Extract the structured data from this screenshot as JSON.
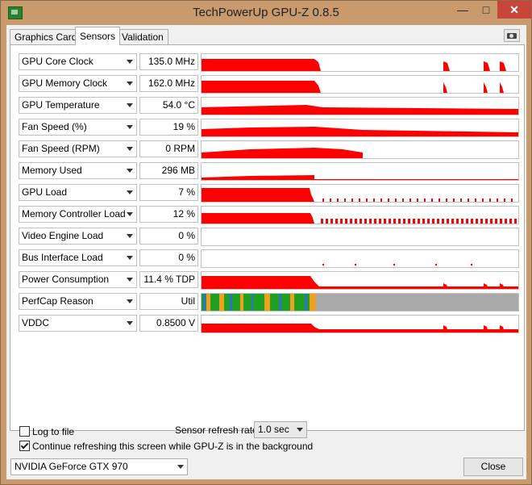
{
  "window": {
    "title": "TechPowerUp GPU-Z 0.8.5",
    "minimize": "—",
    "maximize": "□",
    "close": "✕"
  },
  "tabs": [
    {
      "label": "Graphics Card"
    },
    {
      "label": "Sensors"
    },
    {
      "label": "Validation"
    }
  ],
  "sensors": [
    {
      "name": "GPU Core Clock",
      "value": "135.0 MHz"
    },
    {
      "name": "GPU Memory Clock",
      "value": "162.0 MHz"
    },
    {
      "name": "GPU Temperature",
      "value": "54.0 °C"
    },
    {
      "name": "Fan Speed (%)",
      "value": "19 %"
    },
    {
      "name": "Fan Speed (RPM)",
      "value": "0 RPM"
    },
    {
      "name": "Memory Used",
      "value": "296 MB"
    },
    {
      "name": "GPU Load",
      "value": "7 %"
    },
    {
      "name": "Memory Controller Load",
      "value": "12 %"
    },
    {
      "name": "Video Engine Load",
      "value": "0 %"
    },
    {
      "name": "Bus Interface Load",
      "value": "0 %"
    },
    {
      "name": "Power Consumption",
      "value": "11.4 % TDP"
    },
    {
      "name": "PerfCap Reason",
      "value": "Util"
    },
    {
      "name": "VDDC",
      "value": "0.8500 V"
    }
  ],
  "options": {
    "log_to_file": "Log to file",
    "refresh_label": "Sensor refresh rate:",
    "refresh_value": "1.0 sec",
    "continue_refresh": "Continue refreshing this screen while GPU-Z is in the background"
  },
  "footer": {
    "gpu_select": "NVIDIA GeForce GTX 970",
    "close_button": "Close"
  },
  "colors": {
    "graph": "#ff0000",
    "perfcap_green": "#20a020",
    "perfcap_orange": "#f0a020",
    "perfcap_blue": "#3070d0",
    "perfcap_idle": "#aaaaaa",
    "titlebar": "#c89a6e",
    "close_button": "#c7453a"
  }
}
